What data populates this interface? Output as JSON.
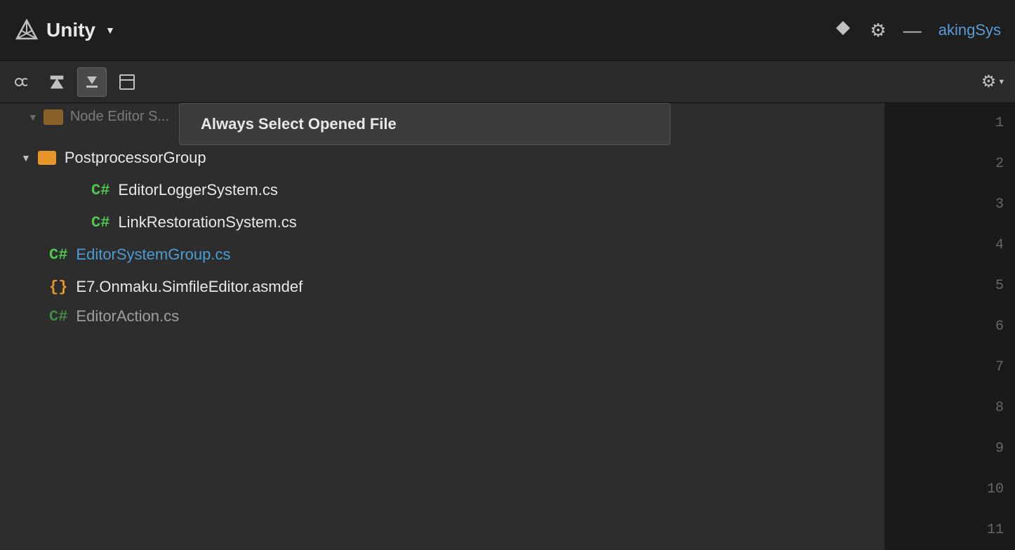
{
  "titlebar": {
    "logo_label": "Unity",
    "dropdown_arrow": "▼",
    "title": "Unity",
    "window_title_partial": "akingSys",
    "icons": {
      "collapse": "⇕",
      "gear": "⚙",
      "minimize": "—"
    }
  },
  "toolbar": {
    "buttons": [
      {
        "id": "sync-btn",
        "label": "⟳",
        "active": false,
        "name": "sync-button"
      },
      {
        "id": "up-btn",
        "label": "↑",
        "active": false,
        "name": "scroll-up-button"
      },
      {
        "id": "down-btn",
        "label": "↓",
        "active": true,
        "name": "scroll-down-button"
      },
      {
        "id": "layout-btn",
        "label": "▣",
        "active": false,
        "name": "layout-button"
      }
    ],
    "gear_label": "⚙"
  },
  "dropdown": {
    "items": [
      {
        "id": "always-select",
        "label": "Always Select Opened File"
      }
    ]
  },
  "file_tree": {
    "header_partial": "Node Editor S...",
    "items": [
      {
        "type": "folder",
        "name": "PostprocessorGroup",
        "expanded": true,
        "children": [
          {
            "type": "cs",
            "name": "EditorLoggerSystem.cs",
            "color": "green"
          },
          {
            "type": "cs",
            "name": "LinkRestorationSystem.cs",
            "color": "green"
          }
        ]
      },
      {
        "type": "cs",
        "name": "EditorSystemGroup.cs",
        "color": "blue"
      },
      {
        "type": "asmdef",
        "name": "E7.Onmaku.SimfileEditor.asmdef",
        "color": "orange"
      },
      {
        "type": "cs",
        "name": "EditorAction.cs",
        "color": "green",
        "partial": true
      }
    ]
  },
  "line_numbers": [
    1,
    2,
    3,
    4,
    5,
    6,
    7,
    8,
    9,
    10,
    11
  ],
  "colors": {
    "bg": "#2d2d2d",
    "panel_bg": "#1e1e1e",
    "accent_blue": "#4b9cd3",
    "accent_green": "#4ec94e",
    "accent_orange": "#e8952a",
    "text_primary": "#e8e8e8",
    "text_muted": "#666666"
  }
}
